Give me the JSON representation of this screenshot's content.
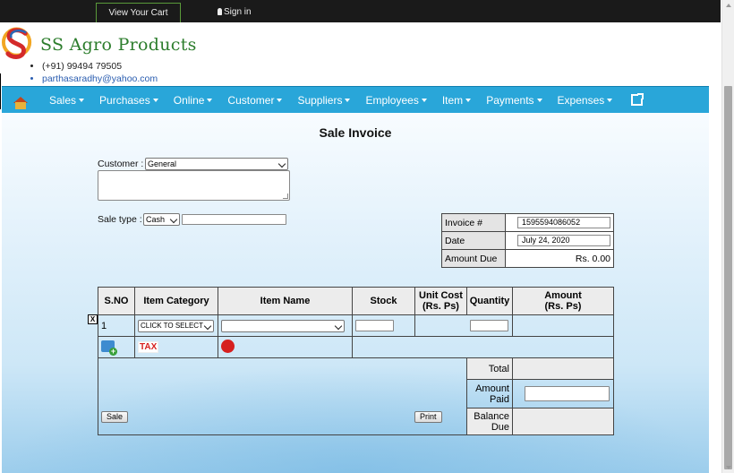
{
  "topbar": {
    "cart_label": "View Your Cart",
    "signin_label": "Sign in"
  },
  "brand": {
    "name": "SS Agro Products",
    "phone": "(+91) 99494 79505",
    "email": "parthasaradhy@yahoo.com"
  },
  "nav": {
    "items": [
      {
        "label": "Sales"
      },
      {
        "label": "Purchases"
      },
      {
        "label": "Online"
      },
      {
        "label": "Customer"
      },
      {
        "label": "Suppliers"
      },
      {
        "label": "Employees"
      },
      {
        "label": "Item"
      },
      {
        "label": "Payments"
      },
      {
        "label": "Expenses"
      }
    ]
  },
  "page": {
    "title": "Sale Invoice"
  },
  "customer": {
    "label": "Customer :",
    "selected": "General",
    "address": ""
  },
  "sale_type": {
    "label": "Sale type :",
    "selected": "Cash",
    "extra": ""
  },
  "invoice": {
    "number_label": "Invoice #",
    "number_value": "1595594086052",
    "date_label": "Date",
    "date_value": "July 24, 2020",
    "due_label": "Amount Due",
    "due_value": "Rs. 0.00"
  },
  "grid": {
    "headers": {
      "sno": "S.NO",
      "category": "Item Category",
      "item": "Item Name",
      "stock": "Stock",
      "unit_cost_1": "Unit Cost",
      "unit_cost_2": "(Rs. Ps)",
      "qty": "Quantity",
      "amount_1": "Amount",
      "amount_2": "(Rs. Ps)"
    },
    "row": {
      "sno": "1",
      "category_selected": "CLICK TO SELECT",
      "item_selected": "",
      "stock": "",
      "qty": ""
    },
    "remove_label": "X",
    "icons": {
      "add": "add-row-icon",
      "tax": "tax-icon",
      "item": "new-item-icon"
    },
    "tax_text": "TAX"
  },
  "totals": {
    "total_label": "Total",
    "paid_label_1": "Amount",
    "paid_label_2": "Paid",
    "paid_value": "",
    "balance_label_1": "Balance",
    "balance_label_2": "Due"
  },
  "buttons": {
    "sale": "Sale",
    "print": "Print"
  },
  "colors": {
    "nav": "#29a6d9",
    "brand": "#2c7d2c",
    "topbar": "#1a1a1a"
  }
}
